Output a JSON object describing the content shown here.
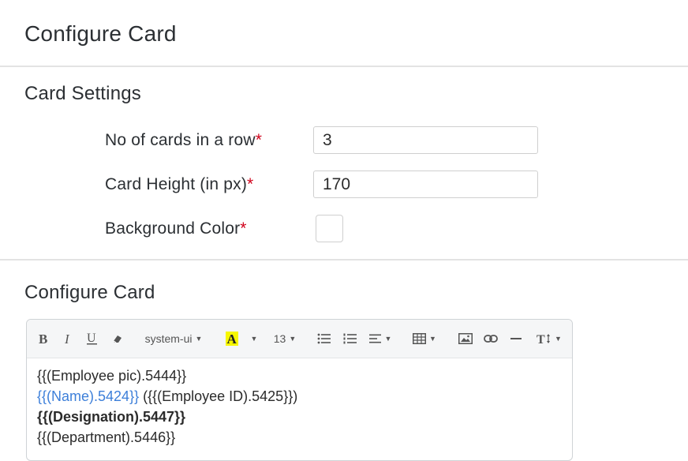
{
  "page": {
    "title": "Configure Card"
  },
  "card_settings": {
    "title": "Card Settings",
    "fields": [
      {
        "label": "No of cards in a row",
        "required": "*",
        "value": "3"
      },
      {
        "label": "Card Height (in px)",
        "required": "*",
        "value": "170"
      },
      {
        "label": "Background Color",
        "required": "*",
        "color": "#ffffff"
      }
    ]
  },
  "configure_card": {
    "title": "Configure Card",
    "toolbar": {
      "font_family": "system-ui",
      "font_size": "13",
      "highlight_color": "#f7f700"
    },
    "content": {
      "line1": "{{(Employee pic).5444}}",
      "line2_name": "{{(Name).5424}}",
      "line2_rest": " ({{(Employee ID).5425}})",
      "line3": "{{(Designation).5447}}",
      "line4": "{{(Department).5446}}"
    }
  }
}
